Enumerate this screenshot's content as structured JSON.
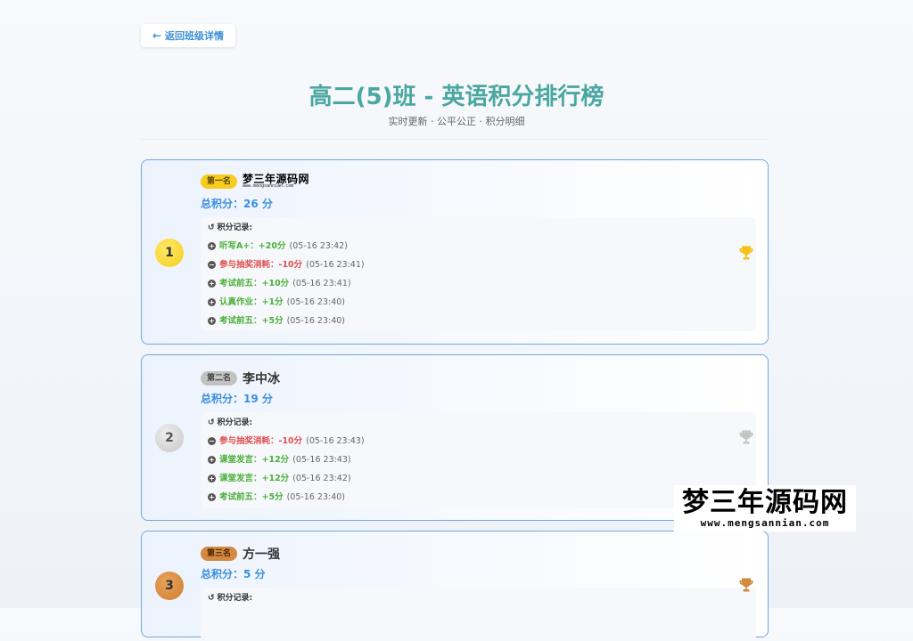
{
  "back_label": "返回班级详情",
  "title": "高二(5)班 - 英语积分排行榜",
  "subtitle": "实时更新 · 公平公正 · 积分明细",
  "records_title": "积分记录:",
  "watermark": {
    "line1": "梦三年源码网",
    "line2": "www.mengsannian.com"
  },
  "colors": {
    "accent": "#3a8ee0",
    "title": "#4aa8a0",
    "plus": "#4caf3a",
    "minus": "#e05050",
    "gold": "#f6cd1d",
    "silver": "#c2c2c2",
    "bronze": "#d3893f"
  },
  "entries": [
    {
      "rank": "1",
      "badge": "第一名",
      "name": "",
      "name_logo": {
        "line1": "梦三年源码网",
        "line2": "www.mengsannian.com"
      },
      "score": "总积分：26 分",
      "records": [
        {
          "type": "plus",
          "label": "听写A+：+20分",
          "time": "(05-16 23:42)"
        },
        {
          "type": "minus",
          "label": "参与抽奖消耗：-10分",
          "time": "(05-16 23:41)"
        },
        {
          "type": "plus",
          "label": "考试前五：+10分",
          "time": "(05-16 23:41)"
        },
        {
          "type": "plus",
          "label": "认真作业：+1分",
          "time": "(05-16 23:40)"
        },
        {
          "type": "plus",
          "label": "考试前五：+5分",
          "time": "(05-16 23:40)"
        }
      ]
    },
    {
      "rank": "2",
      "badge": "第二名",
      "name": "李中冰",
      "score": "总积分：19 分",
      "records": [
        {
          "type": "minus",
          "label": "参与抽奖消耗：-10分",
          "time": "(05-16 23:43)"
        },
        {
          "type": "plus",
          "label": "课堂发言：+12分",
          "time": "(05-16 23:43)"
        },
        {
          "type": "plus",
          "label": "课堂发言：+12分",
          "time": "(05-16 23:42)"
        },
        {
          "type": "plus",
          "label": "考试前五：+5分",
          "time": "(05-16 23:40)"
        }
      ]
    },
    {
      "rank": "3",
      "badge": "第三名",
      "name": "方一强",
      "score": "总积分：5 分",
      "records": []
    }
  ]
}
